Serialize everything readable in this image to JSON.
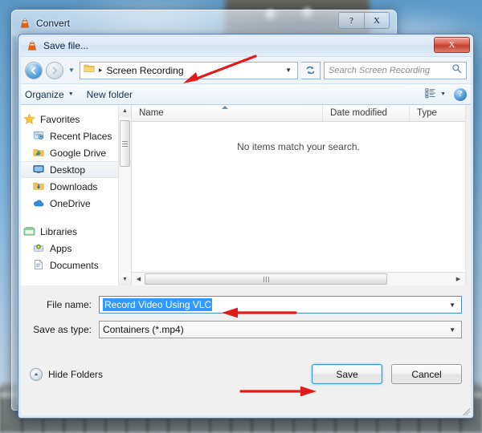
{
  "desktop": {
    "watermark": ""
  },
  "convert_window": {
    "title": "Convert",
    "icon": "vlc-cone-icon",
    "help_label": "?",
    "close_label": "X"
  },
  "save_dialog": {
    "title": "Save file...",
    "icon": "vlc-cone-icon",
    "close_label": "X",
    "nav": {
      "back_icon": "back-arrow-icon",
      "forward_icon": "forward-arrow-icon",
      "history_icon": "chevron-down-icon",
      "folder_icon": "folder-icon",
      "breadcrumb_separator": "▸",
      "breadcrumb": "Screen Recording",
      "address_dropdown_icon": "chevron-down-icon",
      "refresh_icon": "refresh-icon"
    },
    "search": {
      "placeholder": "Search Screen Recording",
      "icon": "search-icon"
    },
    "toolbar": {
      "organize_label": "Organize",
      "organize_caret": "▼",
      "new_folder_label": "New folder",
      "view_icon": "view-list-icon",
      "view_caret": "▼",
      "help_icon": "help-circle-icon",
      "help_label": "?"
    },
    "sidebar": {
      "groups": [
        {
          "header": {
            "label": "Favorites",
            "icon": "star-icon"
          },
          "items": [
            {
              "label": "Recent Places",
              "icon": "recent-places-icon",
              "selected": false
            },
            {
              "label": "Google Drive",
              "icon": "google-drive-icon",
              "selected": false
            },
            {
              "label": "Desktop",
              "icon": "desktop-icon",
              "selected": true
            },
            {
              "label": "Downloads",
              "icon": "downloads-icon",
              "selected": false
            },
            {
              "label": "OneDrive",
              "icon": "onedrive-cloud-icon",
              "selected": false
            }
          ]
        },
        {
          "header": {
            "label": "Libraries",
            "icon": "libraries-icon"
          },
          "items": [
            {
              "label": "Apps",
              "icon": "apps-icon",
              "selected": false
            },
            {
              "label": "Documents",
              "icon": "document-icon",
              "selected": false
            }
          ]
        }
      ],
      "scroll_up_icon": "scroll-up-arrow-icon",
      "scroll_down_icon": "scroll-down-arrow-icon"
    },
    "file_list": {
      "columns": [
        "Name",
        "Date modified",
        "Type"
      ],
      "sort_column": "Name",
      "sort_direction": "ascending",
      "rows": [],
      "empty_message": "No items match your search.",
      "hscroll_left_icon": "scroll-left-arrow-icon",
      "hscroll_right_icon": "scroll-right-arrow-icon"
    },
    "form": {
      "file_name_label": "File name:",
      "file_name_value": "Record Video Using VLC",
      "file_name_selected": true,
      "file_name_dropdown_icon": "chevron-down-icon",
      "save_as_type_label": "Save as type:",
      "save_as_type_value": "Containers (*.mp4)",
      "save_as_type_dropdown_icon": "chevron-down-icon"
    },
    "footer": {
      "hide_folders_label": "Hide Folders",
      "hide_folders_icon": "chevron-up-circle-icon",
      "save_label": "Save",
      "cancel_label": "Cancel",
      "focused_button": "Save"
    }
  },
  "annotations": {
    "color": "#e01b1b",
    "arrows": [
      {
        "name": "arrow-to-breadcrumb",
        "direction": "down-left"
      },
      {
        "name": "arrow-to-filename",
        "direction": "left"
      },
      {
        "name": "arrow-to-save-button",
        "direction": "right"
      }
    ]
  },
  "colors": {
    "selection_blue": "#3399ff",
    "focus_border": "#3c9ad4",
    "dialog_bg": "#f0f0f0",
    "annotation_red": "#e01b1b"
  }
}
